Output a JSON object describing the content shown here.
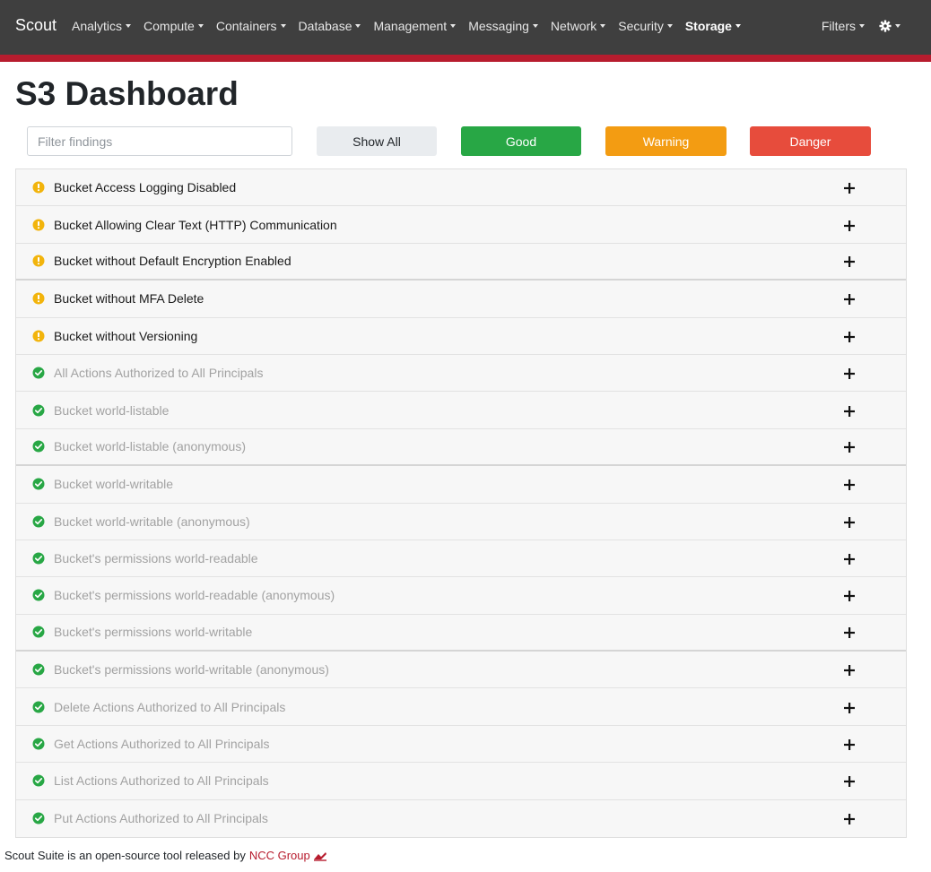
{
  "navbar": {
    "brand": "Scout",
    "items": [
      {
        "label": "Analytics",
        "active": false
      },
      {
        "label": "Compute",
        "active": false
      },
      {
        "label": "Containers",
        "active": false
      },
      {
        "label": "Database",
        "active": false
      },
      {
        "label": "Management",
        "active": false
      },
      {
        "label": "Messaging",
        "active": false
      },
      {
        "label": "Network",
        "active": false
      },
      {
        "label": "Security",
        "active": false
      },
      {
        "label": "Storage",
        "active": true
      }
    ],
    "filters_label": "Filters",
    "settings_icon": "gear-icon",
    "accent_color": "#b71c2e",
    "background_color": "#3f3f3f"
  },
  "page": {
    "title": "S3 Dashboard"
  },
  "filter_bar": {
    "placeholder": "Filter findings",
    "value": "",
    "buttons": {
      "show_all": "Show All",
      "good": "Good",
      "warning": "Warning",
      "danger": "Danger"
    },
    "colors": {
      "good": "#28a745",
      "warning": "#f39c12",
      "danger": "#e74c3c"
    }
  },
  "findings": [
    {
      "label": "Bucket Access Logging Disabled",
      "status": "warning",
      "icon": "warning-icon"
    },
    {
      "label": "Bucket Allowing Clear Text (HTTP) Communication",
      "status": "warning",
      "icon": "warning-icon"
    },
    {
      "label": "Bucket without Default Encryption Enabled",
      "status": "warning",
      "icon": "warning-icon"
    },
    {
      "label": "Bucket without MFA Delete",
      "status": "warning",
      "icon": "warning-icon"
    },
    {
      "label": "Bucket without Versioning",
      "status": "warning",
      "icon": "warning-icon"
    },
    {
      "label": "All Actions Authorized to All Principals",
      "status": "good",
      "icon": "check-circle-icon"
    },
    {
      "label": "Bucket world-listable",
      "status": "good",
      "icon": "check-circle-icon"
    },
    {
      "label": "Bucket world-listable (anonymous)",
      "status": "good",
      "icon": "check-circle-icon"
    },
    {
      "label": "Bucket world-writable",
      "status": "good",
      "icon": "check-circle-icon"
    },
    {
      "label": "Bucket world-writable (anonymous)",
      "status": "good",
      "icon": "check-circle-icon"
    },
    {
      "label": "Bucket's permissions world-readable",
      "status": "good",
      "icon": "check-circle-icon"
    },
    {
      "label": "Bucket's permissions world-readable (anonymous)",
      "status": "good",
      "icon": "check-circle-icon"
    },
    {
      "label": "Bucket's permissions world-writable",
      "status": "good",
      "icon": "check-circle-icon"
    },
    {
      "label": "Bucket's permissions world-writable (anonymous)",
      "status": "good",
      "icon": "check-circle-icon"
    },
    {
      "label": "Delete Actions Authorized to All Principals",
      "status": "good",
      "icon": "check-circle-icon"
    },
    {
      "label": "Get Actions Authorized to All Principals",
      "status": "good",
      "icon": "check-circle-icon"
    },
    {
      "label": "List Actions Authorized to All Principals",
      "status": "good",
      "icon": "check-circle-icon"
    },
    {
      "label": "Put Actions Authorized to All Principals",
      "status": "good",
      "icon": "check-circle-icon"
    }
  ],
  "status_colors": {
    "warning": "#f2b40c",
    "good": "#28a745"
  },
  "footer": {
    "text": "Scout Suite is an open-source tool released by",
    "link_text": "NCC Group",
    "logo_icon": "ncc-group-logo-icon",
    "link_color": "#b71c2e"
  }
}
